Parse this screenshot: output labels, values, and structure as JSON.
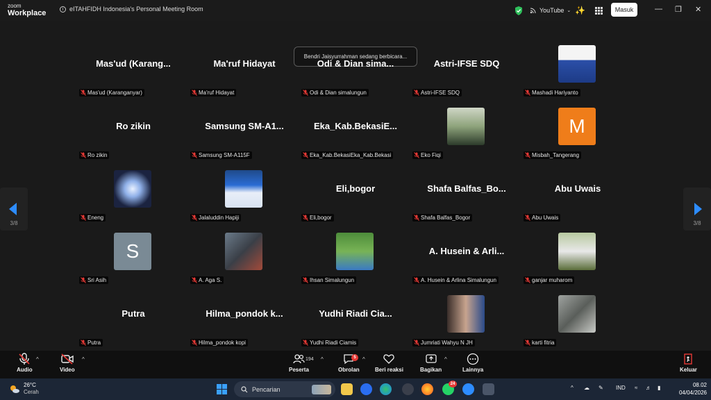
{
  "titlebar": {
    "logo_top": "zoom",
    "logo_bottom": "Workplace",
    "room_title": "eITAHFIDH Indonesia's Personal Meeting Room",
    "youtube_label": "YouTube",
    "signin_label": "Masuk"
  },
  "stage": {
    "speaking_banner": "Bendri Jaisyurrahman sedang berbicara...",
    "page_indicator": "3/8"
  },
  "participants": [
    {
      "display": "Mas'ud  (Karang...",
      "tag": "Mas'ud (Karanganyar)"
    },
    {
      "display": "Ma'ruf Hidayat",
      "tag": "Ma'ruf Hidayat"
    },
    {
      "display": "Odi & Dian sima...",
      "tag": "Odi & Dian simalungun"
    },
    {
      "display": "Astri-IFSE SDQ",
      "tag": "Astri-IFSE SDQ"
    },
    {
      "display": "",
      "tag": "Mashadi Hariyanto",
      "avatar": "photo-man-blue-suit"
    },
    {
      "display": "Ro zikin",
      "tag": "Ro zikin"
    },
    {
      "display": "Samsung  SM-A1...",
      "tag": "Samsung SM-A115F"
    },
    {
      "display": "Eka_Kab.BekasiE...",
      "tag": "Eka_Kab.BekasiEka_Kab.Bekasi"
    },
    {
      "display": "",
      "tag": "Eko Fiqi",
      "avatar": "photo-motorbike"
    },
    {
      "display": "",
      "tag": "Misbah_Tangerang",
      "avatar": "initial",
      "initial": "M",
      "color": "#ef7d1a"
    },
    {
      "display": "",
      "tag": "Eneng",
      "avatar": "photo-white-flower"
    },
    {
      "display": "",
      "tag": "Jalaluddin Hapiji",
      "avatar": "photo-banner"
    },
    {
      "display": "Eli,bogor",
      "tag": "Eli,bogor"
    },
    {
      "display": "Shafa  Balfas_Bo...",
      "tag": "Shafa Balfas_Bogor"
    },
    {
      "display": "Abu Uwais",
      "tag": "Abu Uwais"
    },
    {
      "display": "",
      "tag": "Sri Asih",
      "avatar": "initial",
      "initial": "S",
      "color": "#7a8a95"
    },
    {
      "display": "",
      "tag": "A. Aga S.",
      "avatar": "photo-car"
    },
    {
      "display": "",
      "tag": "Ihsan Simalungun",
      "avatar": "photo-archery"
    },
    {
      "display": "A. Husein & Arli...",
      "tag": "A. Husein & Arlina Simalungun"
    },
    {
      "display": "",
      "tag": "ganjar muharom",
      "avatar": "photo-man-outdoor"
    },
    {
      "display": "Putra",
      "tag": "Putra"
    },
    {
      "display": "Hilma_pondok  k...",
      "tag": "Hilma_pondok kopi"
    },
    {
      "display": "Yudhi Riadi Cia...",
      "tag": "Yudhi Riadi Ciamis"
    },
    {
      "display": "",
      "tag": "Jumriati Wahyu N JH",
      "avatar": "photo-couple"
    },
    {
      "display": "",
      "tag": "karti fitria",
      "avatar": "photo-plant"
    }
  ],
  "controls": {
    "audio": "Audio",
    "video": "Video",
    "participants": "Peserta",
    "participants_count": "194",
    "chat": "Obrolan",
    "chat_badge": "5",
    "reactions": "Beri reaksi",
    "share": "Bagikan",
    "more": "Lainnya",
    "leave": "Keluar"
  },
  "taskbar": {
    "temp": "26°C",
    "condition": "Cerah",
    "search_placeholder": "Pencarian",
    "whatsapp_badge": "24",
    "lang": "IND",
    "time": "08.02",
    "date": "04/04/2026"
  }
}
